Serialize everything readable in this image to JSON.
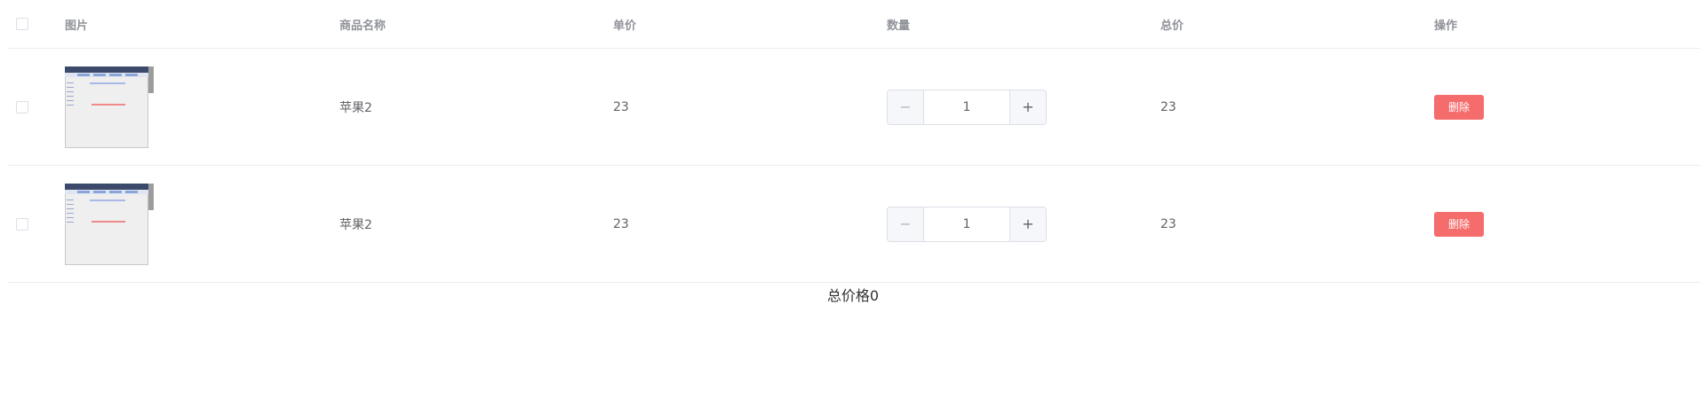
{
  "table": {
    "headers": {
      "image": "图片",
      "name": "商品名称",
      "price": "单价",
      "quantity": "数量",
      "total": "总价",
      "operation": "操作"
    },
    "rows": [
      {
        "name": "苹果2",
        "price": "23",
        "quantity": "1",
        "total": "23",
        "delete_label": "删除"
      },
      {
        "name": "苹果2",
        "price": "23",
        "quantity": "1",
        "total": "23",
        "delete_label": "删除"
      }
    ]
  },
  "stepper": {
    "minus_icon": "−",
    "plus_icon": "+"
  },
  "summary": {
    "total_label": "总价格0"
  },
  "colors": {
    "delete_button": "#f56c6c",
    "border": "#ebeef5",
    "header_text": "#909399"
  }
}
